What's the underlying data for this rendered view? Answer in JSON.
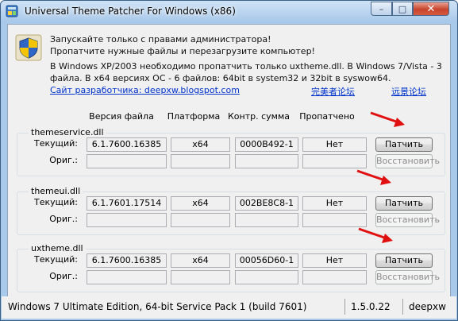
{
  "window": {
    "title": "Universal Theme Patcher For Windows   (x86)",
    "controls": {
      "minimize": "–",
      "maximize": "□",
      "close": "✕"
    }
  },
  "info": {
    "warning": "Запускайте только с правами администратора!\nПропатчите нужные файлы и перезагрузите компьютер!",
    "description": "В Windows XP/2003 необходимо пропатчить только uxtheme.dll. В Windows 7/Vista - 3 файла. В x64 версиях ОС - 6 файлов: 64bit в system32 и 32bit в syswow64."
  },
  "links": {
    "developer_site": "Сайт разработчика: deepxw.blogspot.com",
    "forum1": "完美者论坛",
    "forum2": "远景论坛"
  },
  "columns": {
    "version": "Версия файла",
    "platform": "Платформа",
    "checksum": "Контр. сумма",
    "patched": "Пропатчено"
  },
  "row_labels": {
    "current": "Текущий:",
    "original": "Ориг.:"
  },
  "buttons": {
    "patch": "Патчить",
    "restore": "Восстановить"
  },
  "files": [
    {
      "name": "themeservice.dll",
      "version": "6.1.7600.16385",
      "platform": "x64",
      "checksum": "0000B492-1",
      "patched": "Нет"
    },
    {
      "name": "themeui.dll",
      "version": "6.1.7601.17514",
      "platform": "x64",
      "checksum": "002BE8C8-1",
      "patched": "Нет"
    },
    {
      "name": "uxtheme.dll",
      "version": "6.1.7600.16385",
      "platform": "x64",
      "checksum": "00056D60-1",
      "patched": "Нет"
    }
  ],
  "status": {
    "os": "Windows 7 Ultimate Edition, 64-bit Service Pack 1 (build 7601)",
    "version": "1.5.0.22",
    "author": "deepxw"
  },
  "colors": {
    "link": "#0033cc",
    "arrow": "#e01010",
    "title_bar": "#a9c9ea",
    "close_button": "#c8442c"
  },
  "icons": [
    "app-icon",
    "uac-shield-icon",
    "red-arrow-icon"
  ]
}
